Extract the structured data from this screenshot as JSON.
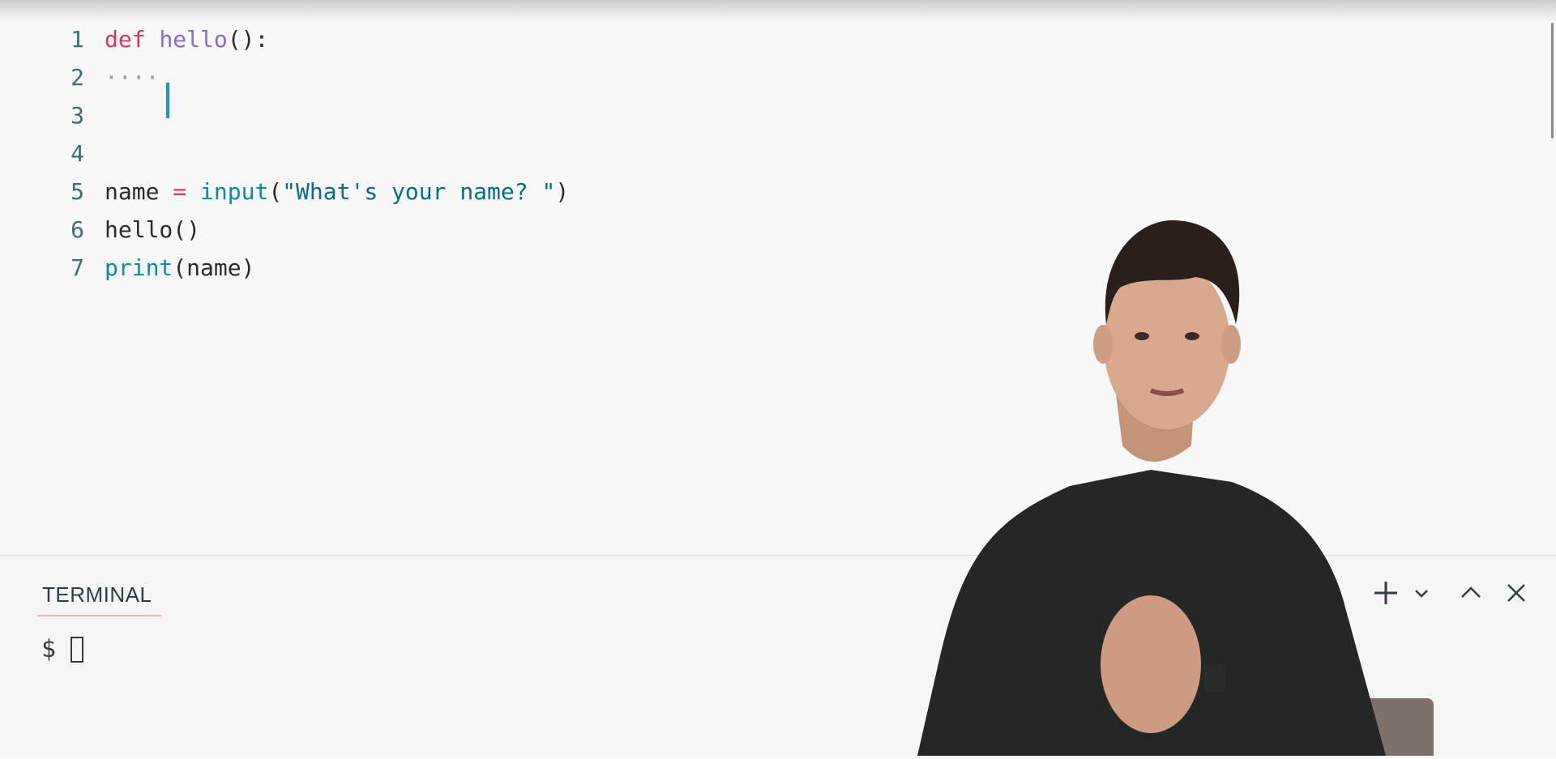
{
  "editor": {
    "lines": [
      {
        "number": "1",
        "tokens": [
          {
            "text": "def",
            "kind": "keyword"
          },
          {
            "text": " ",
            "kind": "plain"
          },
          {
            "text": "hello",
            "kind": "func"
          },
          {
            "text": "():",
            "kind": "plain"
          }
        ]
      },
      {
        "number": "2",
        "tokens": [
          {
            "text": "····",
            "kind": "whitespace"
          }
        ]
      },
      {
        "number": "3",
        "tokens": []
      },
      {
        "number": "4",
        "tokens": []
      },
      {
        "number": "5",
        "tokens": [
          {
            "text": "name ",
            "kind": "plain"
          },
          {
            "text": "=",
            "kind": "op"
          },
          {
            "text": " ",
            "kind": "plain"
          },
          {
            "text": "input",
            "kind": "builtin"
          },
          {
            "text": "(",
            "kind": "plain"
          },
          {
            "text": "\"What's your name? \"",
            "kind": "string"
          },
          {
            "text": ")",
            "kind": "plain"
          }
        ]
      },
      {
        "number": "6",
        "tokens": [
          {
            "text": "hello()",
            "kind": "plain"
          }
        ]
      },
      {
        "number": "7",
        "tokens": [
          {
            "text": "print",
            "kind": "builtin"
          },
          {
            "text": "(name)",
            "kind": "plain"
          }
        ]
      }
    ]
  },
  "terminal": {
    "tab_label": "TERMINAL",
    "prompt": "$",
    "icons": [
      "plus-icon",
      "chevron-down-icon",
      "chevron-up-icon",
      "close-icon"
    ]
  },
  "colors": {
    "keyword": "#d7355a",
    "function": "#8f6bbf",
    "builtin": "#0a8ba4",
    "string": "#0b6a84",
    "cursor": "#1297c7"
  }
}
